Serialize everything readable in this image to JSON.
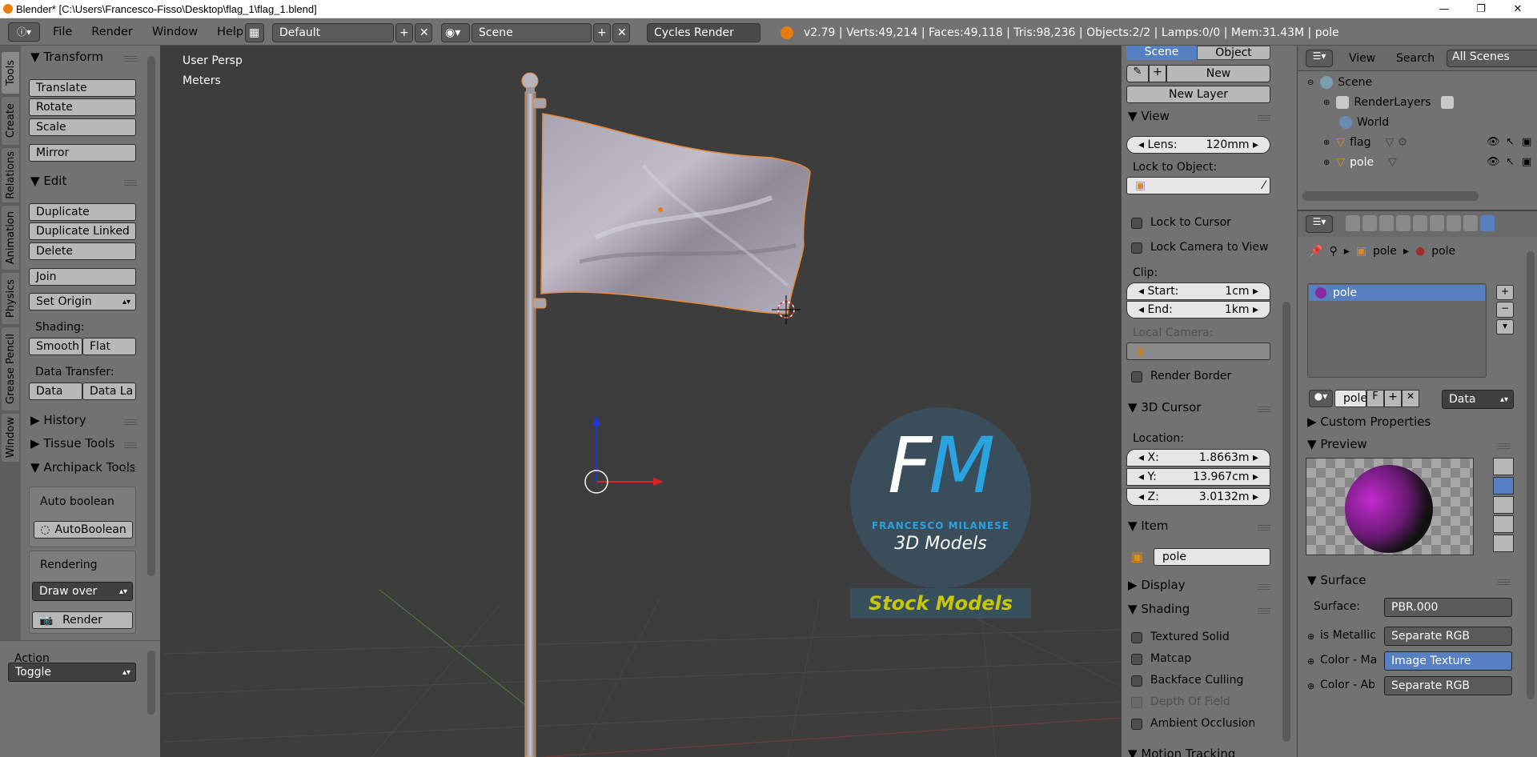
{
  "window": {
    "title": "Blender* [C:\\Users\\Francesco-Fisso\\Desktop\\flag_1\\flag_1.blend]",
    "minimize": "—",
    "maximize": "❐",
    "close": "✕"
  },
  "menu": {
    "items": [
      "File",
      "Render",
      "Window",
      "Help"
    ],
    "layout": "Default",
    "scene": "Scene",
    "engine": "Cycles Render",
    "stats": "v2.79 | Verts:49,214 | Faces:49,118 | Tris:98,236 | Objects:2/2 | Lamps:0/0 | Mem:31.43M | pole"
  },
  "tabs": [
    "Tools",
    "Create",
    "Relations",
    "Animation",
    "Physics",
    "Grease Pencil",
    "Window"
  ],
  "tools": {
    "transform": {
      "header": "Transform",
      "buttons": [
        "Translate",
        "Rotate",
        "Scale"
      ],
      "mirror": "Mirror"
    },
    "edit": {
      "header": "Edit",
      "buttons": [
        "Duplicate",
        "Duplicate Linked",
        "Delete"
      ],
      "join": "Join",
      "set_origin": "Set Origin",
      "shading_label": "Shading:",
      "smooth": "Smooth",
      "flat": "Flat",
      "data_transfer_label": "Data Transfer:",
      "data": "Data",
      "data_la": "Data La"
    },
    "history": "History",
    "tissue": "Tissue Tools",
    "archipack": "Archipack Tools",
    "auto_boolean_label": "Auto boolean",
    "auto_boolean_btn": "AutoBoolean",
    "rendering_label": "Rendering",
    "draw_over": "Draw over",
    "render_btn": "Render"
  },
  "action": {
    "label": "Action",
    "value": "Toggle"
  },
  "viewport": {
    "persp": "User Persp",
    "units": "Meters",
    "logo_letters": "FM",
    "logo_name": "FRANCESCO MILANESE",
    "logo_sub": "3D Models",
    "stock": "Stock Models"
  },
  "viewprops": {
    "tab_scene": "Scene",
    "tab_object": "Object",
    "new": "New",
    "new_layer": "New Layer",
    "view_header": "View",
    "lens_label": "Lens:",
    "lens_value": "120mm",
    "lock_to_object": "Lock to Object:",
    "lock_cursor": "Lock to Cursor",
    "lock_camera": "Lock Camera to View",
    "clip": "Clip:",
    "start_label": "Start:",
    "start_value": "1cm",
    "end_label": "End:",
    "end_value": "1km",
    "local_camera": "Local Camera:",
    "render_border": "Render Border",
    "cursor_header": "3D Cursor",
    "location": "Location:",
    "x_label": "X:",
    "x_value": "1.8663m",
    "y_label": "Y:",
    "y_value": "13.967cm",
    "z_label": "Z:",
    "z_value": "3.0132m",
    "item_header": "Item",
    "item_name": "pole",
    "display": "Display",
    "shading_header": "Shading",
    "shading_opts": [
      "Textured Solid",
      "Matcap",
      "Backface Culling",
      "Depth Of Field",
      "Ambient Occlusion"
    ],
    "motion": "Motion Tracking"
  },
  "outliner": {
    "view": "View",
    "search": "Search",
    "all_scenes": "All Scenes",
    "items": [
      "Scene",
      "RenderLayers",
      "World",
      "flag",
      "pole"
    ]
  },
  "props": {
    "breadcrumb_obj": "pole",
    "breadcrumb_mat": "pole",
    "slot": "pole",
    "mat_name": "pole",
    "mat_f": "F",
    "data_dd": "Data",
    "custom_props": "Custom Properties",
    "preview": "Preview",
    "surface_header": "Surface",
    "surface_label": "Surface:",
    "surface_value": "PBR.000",
    "rows": [
      {
        "label": "is Metallic",
        "value": "Separate RGB"
      },
      {
        "label": "Color - Ma",
        "value": "Image Texture"
      },
      {
        "label": "Color - Ab",
        "value": "Separate RGB"
      }
    ]
  },
  "colors": {
    "accent_blue": "#5680c2",
    "selection_orange": "#e88a3a",
    "logo_blue": "#2aa3e0",
    "stock_yellow": "#c8c800"
  }
}
